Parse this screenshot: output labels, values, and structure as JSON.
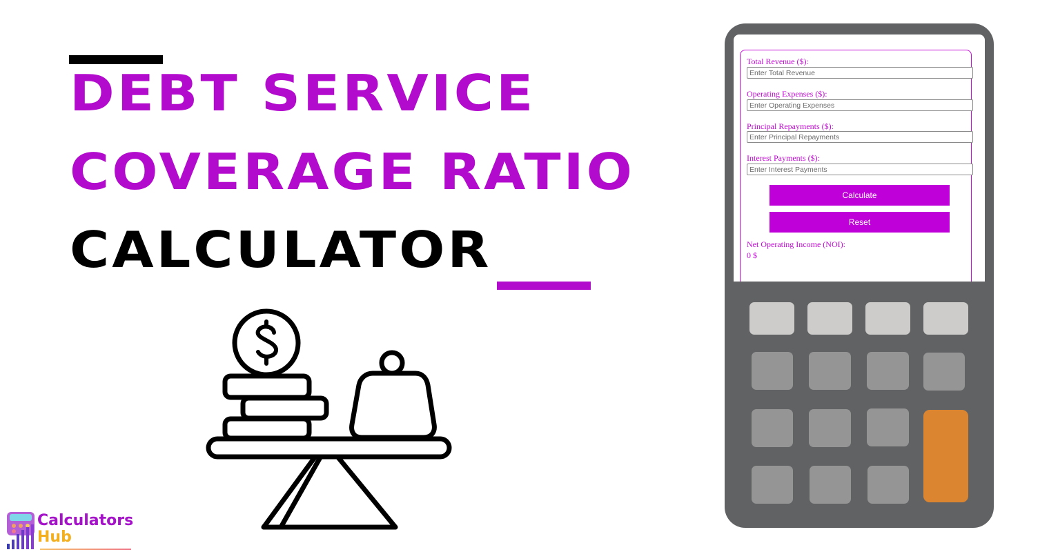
{
  "hero": {
    "title_line1": "DEBT SERVICE",
    "title_line2": "COVERAGE RATIO",
    "title_line3": "CALCULATOR",
    "accent_color": "#b30bce"
  },
  "illustration": {
    "icon": "balance-scale-money-vs-weight-icon"
  },
  "calculator": {
    "fields": [
      {
        "label": "Total Revenue ($):",
        "placeholder": "Enter Total Revenue",
        "value": ""
      },
      {
        "label": "Operating Expenses ($):",
        "placeholder": "Enter Operating Expenses",
        "value": ""
      },
      {
        "label": "Principal Repayments ($):",
        "placeholder": "Enter Principal Repayments",
        "value": ""
      },
      {
        "label": "Interest Payments ($):",
        "placeholder": "Enter Interest Payments",
        "value": ""
      }
    ],
    "calculate_label": "Calculate",
    "reset_label": "Reset",
    "result_label": "Net Operating Income (NOI):",
    "result_value": "0 $",
    "button_color": "#c000d8",
    "body_color": "#616264",
    "equals_key_color": "#dc8530"
  },
  "logo": {
    "line1": "Calculators",
    "line2": "Hub"
  }
}
